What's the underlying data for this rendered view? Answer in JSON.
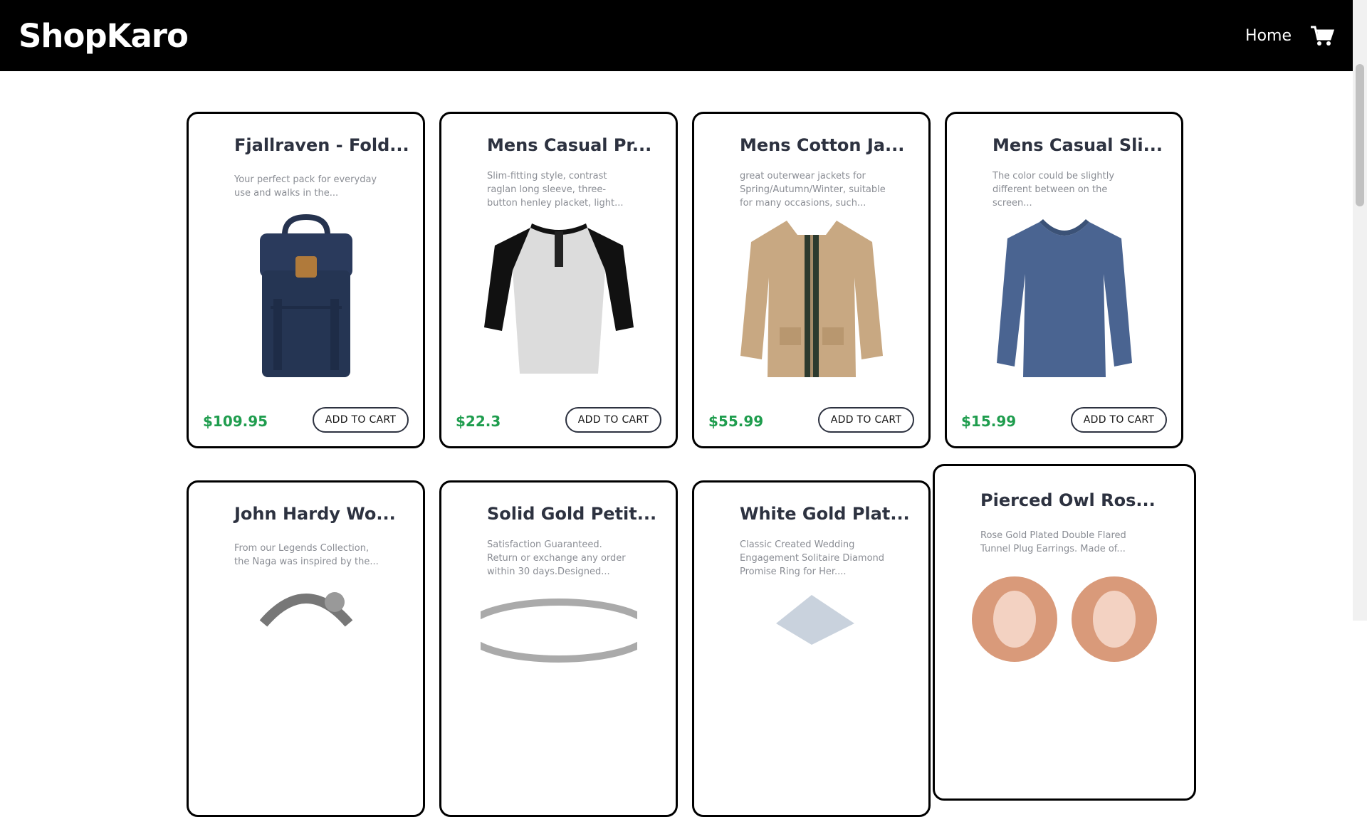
{
  "navbar": {
    "brand": "ShopKaro",
    "home_link": "Home",
    "cart_icon": "shopping-cart-icon"
  },
  "products": [
    {
      "title": "Fjallraven - Fold...",
      "description": "Your perfect pack for everyday use and walks in the...",
      "price": "$109.95",
      "button": "ADD TO CART"
    },
    {
      "title": "Mens Casual Pr...",
      "description": "Slim-fitting style, contrast raglan long sleeve, three-button henley placket, light...",
      "price": "$22.3",
      "button": "ADD TO CART"
    },
    {
      "title": "Mens Cotton Ja...",
      "description": "great outerwear jackets for Spring/Autumn/Winter, suitable for many occasions, such...",
      "price": "$55.99",
      "button": "ADD TO CART"
    },
    {
      "title": "Mens Casual Sli...",
      "description": "The color could be slightly different between on the screen...",
      "price": "$15.99",
      "button": "ADD TO CART"
    },
    {
      "title": "John Hardy Wo...",
      "description": "From our Legends Collection, the Naga was inspired by the..."
    },
    {
      "title": "Solid Gold Petit...",
      "description": "Satisfaction Guaranteed. Return or exchange any order within 30 days.Designed..."
    },
    {
      "title": "White Gold Plat...",
      "description": "Classic Created Wedding Engagement Solitaire Diamond Promise Ring for Her...."
    },
    {
      "title": "Pierced Owl Ros...",
      "description": "Rose Gold Plated Double Flared Tunnel Plug Earrings. Made of..."
    }
  ],
  "colors": {
    "navbar_bg": "#000000",
    "price": "#1f9d4e",
    "title": "#2d3240"
  }
}
